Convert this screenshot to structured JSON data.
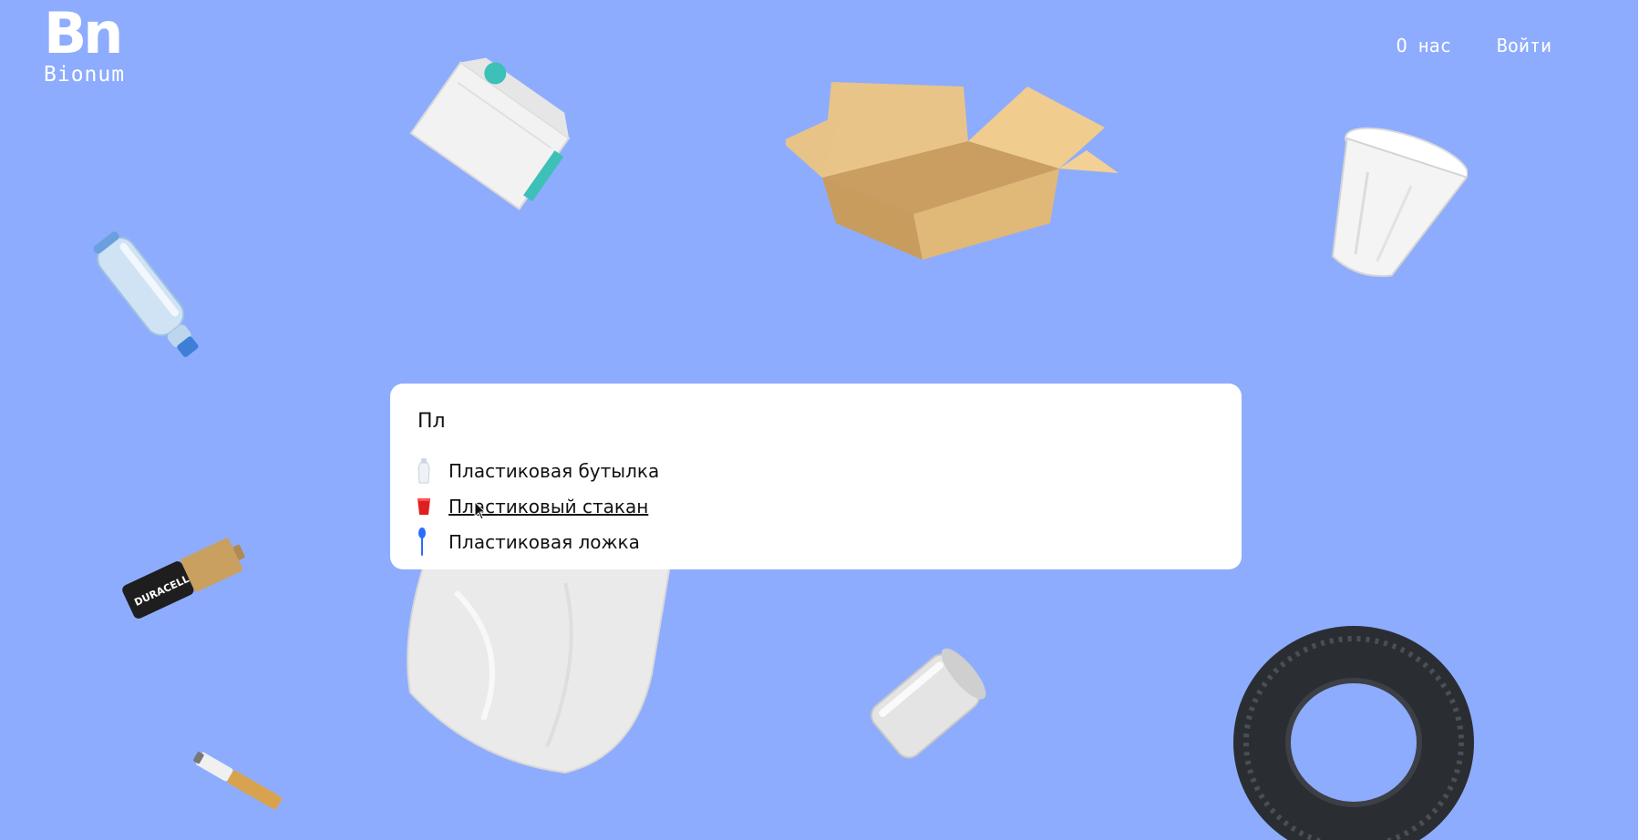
{
  "brand": {
    "mark": "Bn",
    "name": "Bionum"
  },
  "nav": {
    "about": "О нас",
    "login": "Войти"
  },
  "search": {
    "value": "Пл",
    "results": [
      {
        "label": "Пластиковая бутылка",
        "icon": "plastic-bottle-icon"
      },
      {
        "label": "Пластиковый стакан",
        "icon": "plastic-cup-icon"
      },
      {
        "label": "Пластиковая ложка",
        "icon": "plastic-spoon-icon"
      }
    ],
    "hovered_index": 1
  },
  "colors": {
    "background": "#8eacfd",
    "panel": "#ffffff",
    "cup_red": "#e02020",
    "spoon_blue": "#2a6cff"
  }
}
